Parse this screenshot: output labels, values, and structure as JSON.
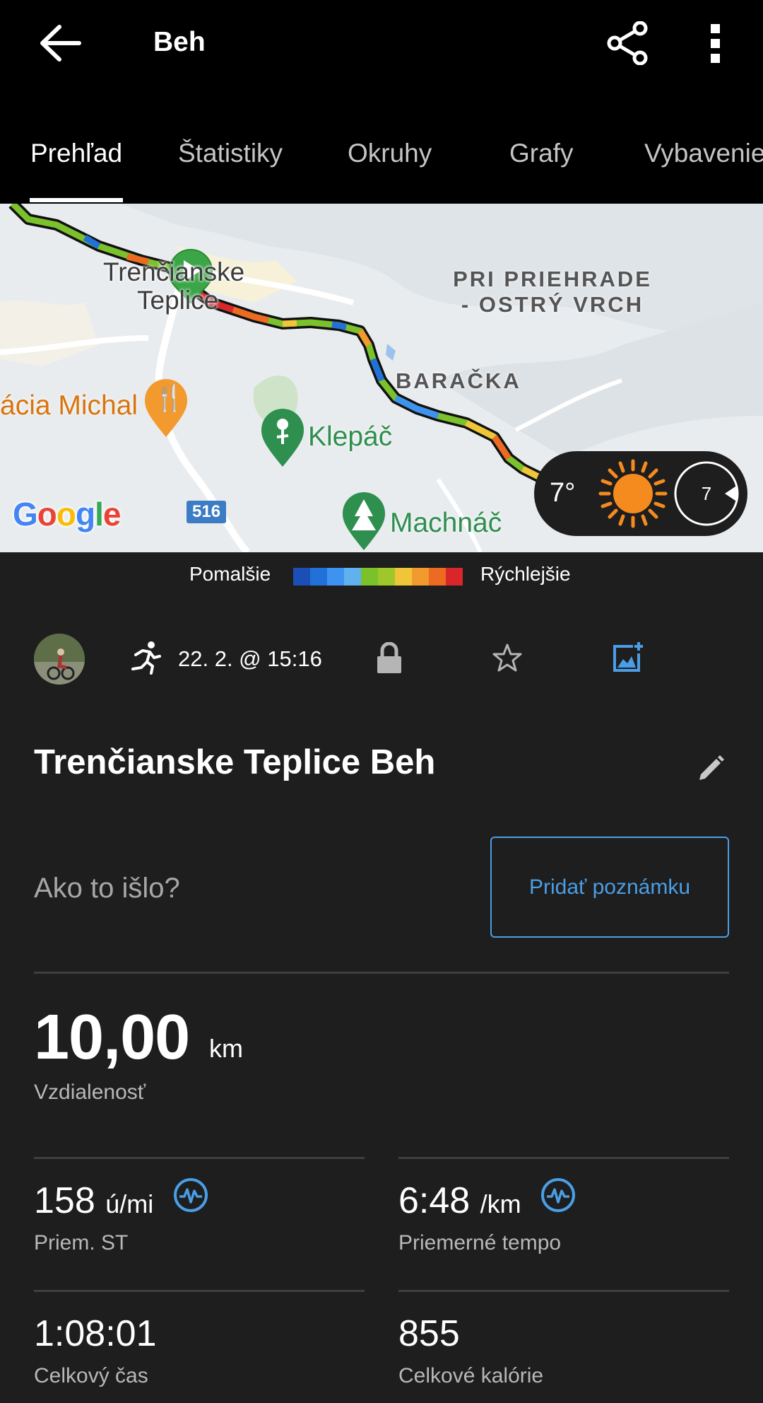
{
  "appbar": {
    "title": "Beh",
    "back_icon": "arrow-back-icon",
    "share_icon": "share-icon",
    "more_icon": "more-vert-icon"
  },
  "tabs": [
    {
      "label": "Prehľad",
      "active": true
    },
    {
      "label": "Štatistiky",
      "active": false
    },
    {
      "label": "Okruhy",
      "active": false
    },
    {
      "label": "Grafy",
      "active": false
    },
    {
      "label": "Vybavenie",
      "active": false
    }
  ],
  "map": {
    "town_line1": "Trenčianske",
    "town_line2": "Teplice",
    "area_line1": "PRI PRIEHRADE",
    "area_line2": "- OSTRÝ VRCH",
    "place_baracka": "BARAČKA",
    "poi_restaurant": "ácia Michal",
    "poi_klepac": "Klepáč",
    "poi_machnac": "Machnáč",
    "road_number": "516",
    "attribution": "Google",
    "weather": {
      "temperature": "7°",
      "condition_icon": "sun-icon",
      "wind": "7"
    }
  },
  "legend": {
    "slow_label": "Pomalšie",
    "fast_label": "Rýchlejšie",
    "colors": [
      "#1c4fb5",
      "#2271d9",
      "#3f93f0",
      "#5fb2ee",
      "#7bc12c",
      "#9fc72c",
      "#f0c53a",
      "#f29a2d",
      "#ec6a22",
      "#d9262a"
    ]
  },
  "meta": {
    "activity_icon": "running-icon",
    "datetime": "22. 2. @ 15:16",
    "privacy_icon": "lock-icon",
    "favorite_icon": "star-outline-icon",
    "photo_icon": "add-photo-icon"
  },
  "activity": {
    "name": "Trenčianske Teplice Beh",
    "prompt": "Ako to išlo?",
    "note_button": "Pridať poznámku"
  },
  "stats": {
    "distance": {
      "value": "10,00",
      "unit": "km",
      "label": "Vzdialenosť"
    },
    "avg_hr": {
      "value": "158",
      "unit": "ú/mi",
      "label": "Priem. ST"
    },
    "avg_pace": {
      "value": "6:48",
      "unit": "/km",
      "label": "Priemerné tempo"
    },
    "total_time": {
      "value": "1:08:01",
      "label": "Celkový čas"
    },
    "calories": {
      "value": "855",
      "label": "Celkové kalórie"
    }
  },
  "colors": {
    "accent": "#4a9ee6",
    "background": "#1e1e1e",
    "bar": "#000000"
  }
}
